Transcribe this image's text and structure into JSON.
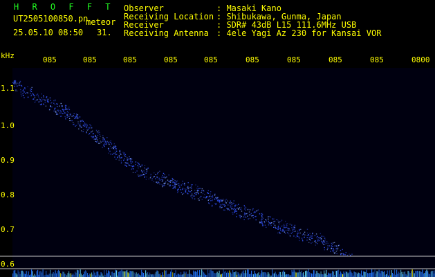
{
  "header": {
    "app_name": "H R O F F T",
    "filename": "UT2505100850.pn",
    "meteor_label": "meteor",
    "datetime": "25.05.10 08:50",
    "count": "31.",
    "labels": {
      "observer": "Observer",
      "location": "Receiving Location",
      "receiver": "Receiver",
      "antenna": "Receiving Antenna"
    },
    "values": {
      "observer": ": Masaki Kano",
      "location": ": Shibukawa, Gunma, Japan",
      "receiver": ": SDR# 43dB L15 111.6MHz USB",
      "antenna": ": 4ele Yagi Az 230 for Kansai VOR"
    }
  },
  "plot": {
    "y_unit": "kHz",
    "y_ticks": [
      "1.1",
      "1.0",
      "0.9",
      "0.8",
      "0.7",
      "0.6"
    ],
    "x_ticks": [
      "085",
      "085",
      "085",
      "085",
      "085",
      "085",
      "085",
      "085",
      "085",
      "0800"
    ]
  },
  "colors": {
    "text": "#ffff00",
    "app_name": "#22ff22",
    "trail": "#3355ff",
    "trail_bright": "#88aaff",
    "noise": "#2277ff",
    "guide": "#c8c8c8"
  }
}
